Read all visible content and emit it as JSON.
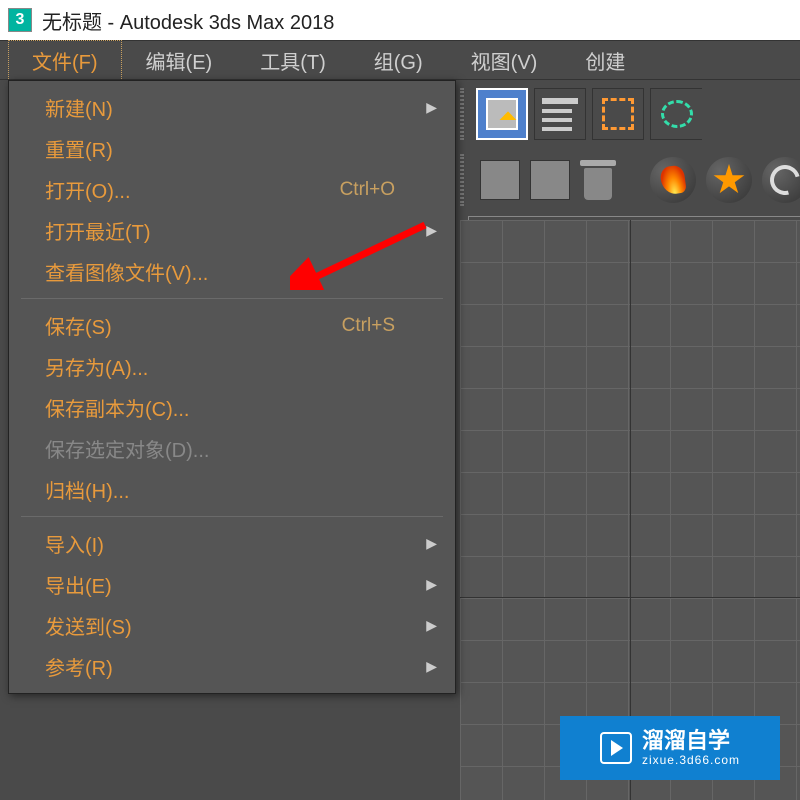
{
  "app": {
    "icon_char": "3",
    "title": "无标题 - Autodesk 3ds Max 2018"
  },
  "menubar": [
    {
      "label": "文件(F)",
      "active": true
    },
    {
      "label": "编辑(E)",
      "active": false
    },
    {
      "label": "工具(T)",
      "active": false
    },
    {
      "label": "组(G)",
      "active": false
    },
    {
      "label": "视图(V)",
      "active": false
    },
    {
      "label": "创建",
      "active": false
    }
  ],
  "file_menu": {
    "groups": [
      [
        {
          "label": "新建(N)",
          "shortcut": "",
          "submenu": true,
          "disabled": false
        },
        {
          "label": "重置(R)",
          "shortcut": "",
          "submenu": false,
          "disabled": false
        },
        {
          "label": "打开(O)...",
          "shortcut": "Ctrl+O",
          "submenu": false,
          "disabled": false
        },
        {
          "label": "打开最近(T)",
          "shortcut": "",
          "submenu": true,
          "disabled": false
        },
        {
          "label": "查看图像文件(V)...",
          "shortcut": "",
          "submenu": false,
          "disabled": false
        }
      ],
      [
        {
          "label": "保存(S)",
          "shortcut": "Ctrl+S",
          "submenu": false,
          "disabled": false
        },
        {
          "label": "另存为(A)...",
          "shortcut": "",
          "submenu": false,
          "disabled": false
        },
        {
          "label": "保存副本为(C)...",
          "shortcut": "",
          "submenu": false,
          "disabled": false
        },
        {
          "label": "保存选定对象(D)...",
          "shortcut": "",
          "submenu": false,
          "disabled": true
        },
        {
          "label": "归档(H)...",
          "shortcut": "",
          "submenu": false,
          "disabled": false
        }
      ],
      [
        {
          "label": "导入(I)",
          "shortcut": "",
          "submenu": true,
          "disabled": false
        },
        {
          "label": "导出(E)",
          "shortcut": "",
          "submenu": true,
          "disabled": false
        },
        {
          "label": "发送到(S)",
          "shortcut": "",
          "submenu": true,
          "disabled": false
        },
        {
          "label": "参考(R)",
          "shortcut": "",
          "submenu": true,
          "disabled": false
        }
      ]
    ]
  },
  "toolbar": {
    "icons": {
      "selection": "selection-cursor",
      "lines": "list-lines",
      "marquee": "dashed-rectangle",
      "lasso": "lasso",
      "cube": "gray-cube",
      "trash": "trash-can",
      "fire": "flame",
      "explosion": "burst",
      "vortex": "swirl"
    }
  },
  "watermark": {
    "main": "溜溜自学",
    "sub": "zixue.3d66.com"
  }
}
